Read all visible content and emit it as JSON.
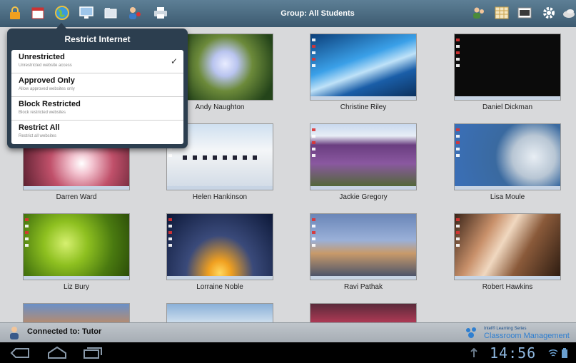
{
  "toolbar": {
    "group_label": "Group: All Students",
    "left_icons": [
      "lock-icon",
      "calendar-icon",
      "globe-icon",
      "monitor-icon",
      "folder-icon",
      "users-icon",
      "printer-icon"
    ],
    "right_icons": [
      "users-icon",
      "grid-icon",
      "layout-icon",
      "gear-icon",
      "blank-screen-icon"
    ]
  },
  "restrict_menu": {
    "title": "Restrict Internet",
    "options": [
      {
        "label": "Unrestricted",
        "description": "Unrestricted website access",
        "selected": true
      },
      {
        "label": "Approved Only",
        "description": "Allow approved websites only",
        "selected": false
      },
      {
        "label": "Block Restricted",
        "description": "Block restricted websites",
        "selected": false
      },
      {
        "label": "Restrict All",
        "description": "Restrict all websites",
        "selected": false
      }
    ]
  },
  "students": [
    {
      "name": "",
      "bg": "#3a6a2e"
    },
    {
      "name": "Andy Naughton",
      "bg": "#2f5a22"
    },
    {
      "name": "Christine Riley",
      "bg": "#2a6fb3"
    },
    {
      "name": "Daniel Dickman",
      "bg": "#0d0d0d"
    },
    {
      "name": "Darren Ward",
      "bg": "#c0506a"
    },
    {
      "name": "Helen Hankinson",
      "bg": "#dfe8f2"
    },
    {
      "name": "Jackie Gregory",
      "bg": "#7b4a8a"
    },
    {
      "name": "Lisa Moule",
      "bg": "#5b7c9e"
    },
    {
      "name": "Liz Bury",
      "bg": "#6e9a1d"
    },
    {
      "name": "Lorraine Noble",
      "bg": "#1c2a4a"
    },
    {
      "name": "Ravi Pathak",
      "bg": "#6b7e9e"
    },
    {
      "name": "Robert Hawkins",
      "bg": "#8a5a3a"
    },
    {
      "name": "",
      "bg": "#b86a3a"
    },
    {
      "name": "",
      "bg": "#5a7a5a"
    },
    {
      "name": "",
      "bg": "#b0304a"
    }
  ],
  "status": {
    "connected": "Connected to: Tutor",
    "brand_line1": "Intel® Learning Series",
    "brand_line2": "Classroom Management"
  },
  "system": {
    "time": "14:56",
    "nav_icons": [
      "back-icon",
      "home-icon",
      "recent-apps-icon"
    ]
  }
}
